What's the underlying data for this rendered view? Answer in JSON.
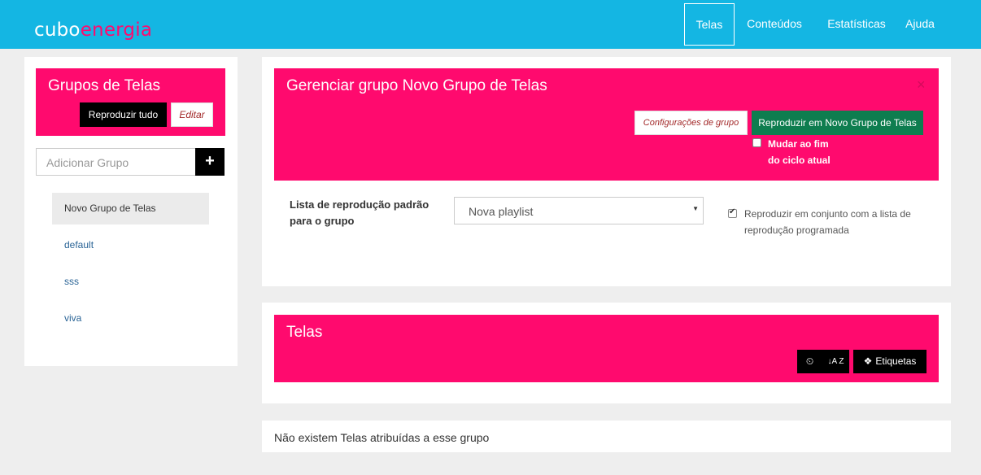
{
  "brand": {
    "part1": "cubo",
    "part2": "energia"
  },
  "nav": [
    {
      "label": "Telas"
    },
    {
      "label": "Conteúdos"
    },
    {
      "label": "Estatísticas"
    },
    {
      "label": "Ajuda"
    }
  ],
  "sidebar": {
    "title": "Grupos de Telas",
    "play_all": "Reproduzir tudo",
    "edit": "Editar",
    "add_placeholder": "Adicionar Grupo",
    "add_button": "+",
    "groups": [
      {
        "label": "Novo Grupo de Telas"
      },
      {
        "label": "default"
      },
      {
        "label": "sss"
      },
      {
        "label": "viva"
      }
    ]
  },
  "manage": {
    "title": "Gerenciar grupo Novo Grupo de Telas",
    "close": "×",
    "config_button": "Configurações de grupo",
    "play_button": "Reproduzir em Novo Grupo de Telas",
    "change_label_1": "Mudar ao fim",
    "change_label_2": "do ciclo atual",
    "playlist_label_1": "Lista de reprodução padrão",
    "playlist_label_2": "para o grupo",
    "playlist_value": "Nova playlist",
    "combined_label_1": "Reproduzir em conjunto com a lista de",
    "combined_label_2": "reprodução programada"
  },
  "screens": {
    "title": "Telas",
    "clock_icon": "⏲",
    "sort_icon": "↓A Z",
    "tags_label": "Etiquetas",
    "empty_message": "Não existem Telas atribuídas a esse grupo"
  }
}
